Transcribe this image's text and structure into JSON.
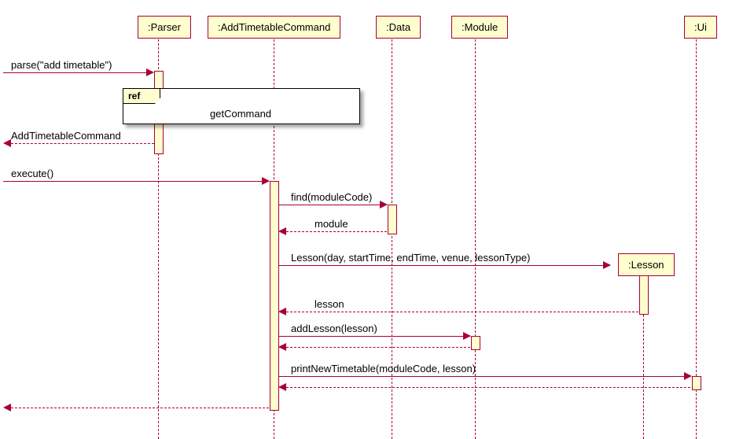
{
  "participants": {
    "parser": ":Parser",
    "addCmd": ":AddTimetableCommand",
    "data": ":Data",
    "module": ":Module",
    "lesson": ":Lesson",
    "ui": ":Ui"
  },
  "ref": {
    "tag": "ref",
    "label": "getCommand"
  },
  "messages": {
    "m1": "parse(\"add timetable\")",
    "m2": "AddTimetableCommand",
    "m3": "execute()",
    "m4": "find(moduleCode)",
    "m5": "module",
    "m6": "Lesson(day, startTime, endTime, venue, lessonType)",
    "m7": "lesson",
    "m8": "addLesson(lesson)",
    "m9": "printNewTimetable(moduleCode, lesson)"
  },
  "chart_data": {
    "type": "sequence-diagram",
    "participants": [
      "Parser",
      "AddTimetableCommand",
      "Data",
      "Module",
      "Lesson",
      "Ui"
    ],
    "interactions": [
      {
        "from": "caller",
        "to": "Parser",
        "message": "parse(\"add timetable\")",
        "type": "sync"
      },
      {
        "ref": "getCommand",
        "over": [
          "Parser",
          "AddTimetableCommand"
        ]
      },
      {
        "from": "Parser",
        "to": "caller",
        "message": "AddTimetableCommand",
        "type": "return"
      },
      {
        "from": "caller",
        "to": "AddTimetableCommand",
        "message": "execute()",
        "type": "sync"
      },
      {
        "from": "AddTimetableCommand",
        "to": "Data",
        "message": "find(moduleCode)",
        "type": "sync"
      },
      {
        "from": "Data",
        "to": "AddTimetableCommand",
        "message": "module",
        "type": "return"
      },
      {
        "from": "AddTimetableCommand",
        "to": "Lesson",
        "message": "Lesson(day, startTime, endTime, venue, lessonType)",
        "type": "create"
      },
      {
        "from": "Lesson",
        "to": "AddTimetableCommand",
        "message": "lesson",
        "type": "return"
      },
      {
        "from": "AddTimetableCommand",
        "to": "Module",
        "message": "addLesson(lesson)",
        "type": "sync"
      },
      {
        "from": "Module",
        "to": "AddTimetableCommand",
        "message": "",
        "type": "return"
      },
      {
        "from": "AddTimetableCommand",
        "to": "Ui",
        "message": "printNewTimetable(moduleCode, lesson)",
        "type": "sync"
      },
      {
        "from": "Ui",
        "to": "AddTimetableCommand",
        "message": "",
        "type": "return"
      },
      {
        "from": "AddTimetableCommand",
        "to": "caller",
        "message": "",
        "type": "return"
      }
    ]
  }
}
